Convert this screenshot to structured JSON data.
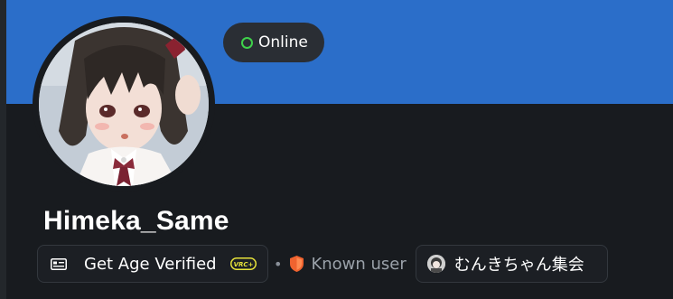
{
  "profile": {
    "username": "Himeka_Same",
    "status": {
      "label": "Online",
      "color": "#3fd14b"
    }
  },
  "badges": {
    "age": {
      "label": "Get Age Verified",
      "icon": "id-card-icon",
      "tag_icon": "vrc-plus-icon",
      "tag_text": "VRC+"
    },
    "separator": "•",
    "trust": {
      "label": "Known user",
      "icon": "shield-icon",
      "color": "#f0632f"
    },
    "group": {
      "label": "むんきちゃん集会",
      "icon": "group-avatar-icon"
    }
  },
  "colors": {
    "banner": "#2b6ec9",
    "background": "#181b1f",
    "vrc_accent": "#e6e23a"
  }
}
